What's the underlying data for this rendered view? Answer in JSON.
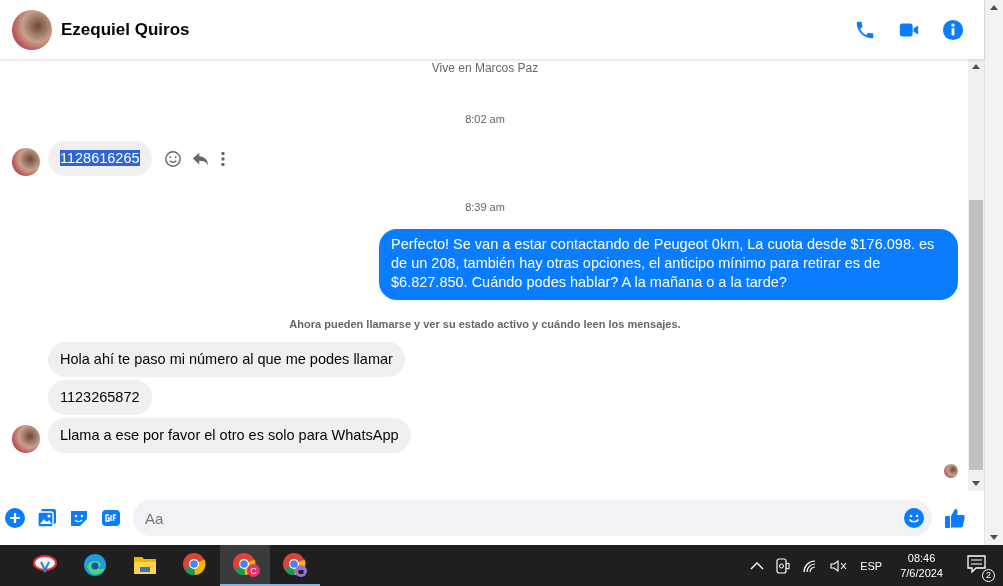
{
  "header": {
    "name": "Ezequiel Quiros"
  },
  "messages": [
    {
      "kind": "notice",
      "text": "Vive en Marcos Paz"
    },
    {
      "kind": "time",
      "text": "8:02 am"
    },
    {
      "kind": "incoming",
      "text": "1128616265",
      "avatar": true,
      "text_selected": true,
      "show_actions": true
    },
    {
      "kind": "time",
      "text": "8:39 am"
    },
    {
      "kind": "outgoing",
      "text": "Perfecto!  Se van a estar contactando de Peugeot 0km, La cuota desde $176.098. es de un 208, también hay otras opciones, el anticipo mínimo para retirar es de $6.827.850. Cuándo podes hablar? A la mañana o a la tarde?"
    },
    {
      "kind": "notice",
      "text": "Ahora pueden llamarse y ver su estado activo y cuándo leen los mensajes."
    },
    {
      "kind": "incoming",
      "text": "Hola ahí te paso mi número al que me podes llamar",
      "avatar": false,
      "text_selected": false,
      "show_actions": false
    },
    {
      "kind": "incoming",
      "text": "1123265872",
      "avatar": false,
      "text_selected": false,
      "show_actions": false
    },
    {
      "kind": "incoming",
      "text": "Llama a ese por favor el otro es solo para WhatsApp",
      "avatar": true,
      "text_selected": false,
      "show_actions": false
    }
  ],
  "composer": {
    "placeholder": "Aa"
  },
  "taskbar": {
    "apps": [
      {
        "kind": "snip",
        "active": false,
        "open": false
      },
      {
        "kind": "edge",
        "active": false,
        "open": false
      },
      {
        "kind": "folder",
        "active": false,
        "open": false
      },
      {
        "kind": "chrome",
        "active": false,
        "open": false
      },
      {
        "kind": "chrome-c",
        "badge": "C",
        "active": true,
        "open": true
      },
      {
        "kind": "chrome-lock",
        "active": false,
        "open": true
      }
    ],
    "language": "ESP",
    "time": "08:46",
    "date": "7/6/2024",
    "notifications": "2"
  }
}
